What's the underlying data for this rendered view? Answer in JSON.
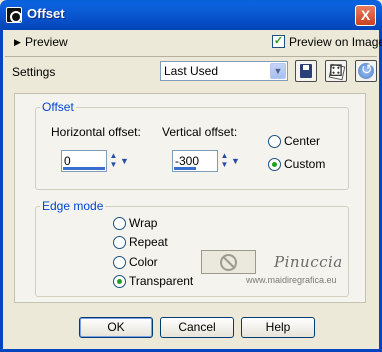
{
  "window": {
    "title": "Offset",
    "close_glyph": "X"
  },
  "preview": {
    "toggle_label": "Preview",
    "checkbox_label": "Preview on Image",
    "checked": true
  },
  "settings": {
    "label": "Settings",
    "preset_value": "Last Used"
  },
  "toolbar": {
    "icons": [
      "save-icon",
      "randomize-icon",
      "reset-icon"
    ]
  },
  "offset": {
    "legend": "Offset",
    "horizontal_label": "Horizontal offset:",
    "horizontal_value": "0",
    "vertical_label": "Vertical offset:",
    "vertical_value": "-300",
    "modes": [
      {
        "label": "Center",
        "selected": false
      },
      {
        "label": "Custom",
        "selected": true
      }
    ]
  },
  "edge_mode": {
    "legend": "Edge mode",
    "options": [
      {
        "label": "Wrap",
        "selected": false
      },
      {
        "label": "Repeat",
        "selected": false
      },
      {
        "label": "Color",
        "selected": false
      },
      {
        "label": "Transparent",
        "selected": true
      }
    ]
  },
  "watermark": {
    "title": "Pinuccia",
    "url": "www.maidiregrafica.eu"
  },
  "buttons": {
    "ok": "OK",
    "cancel": "Cancel",
    "help": "Help"
  },
  "colors": {
    "title_bar": "#0956d0",
    "dialog_bg": "#ece9d8",
    "legend_text": "#0046d5",
    "radio_dot": "#21a121"
  }
}
